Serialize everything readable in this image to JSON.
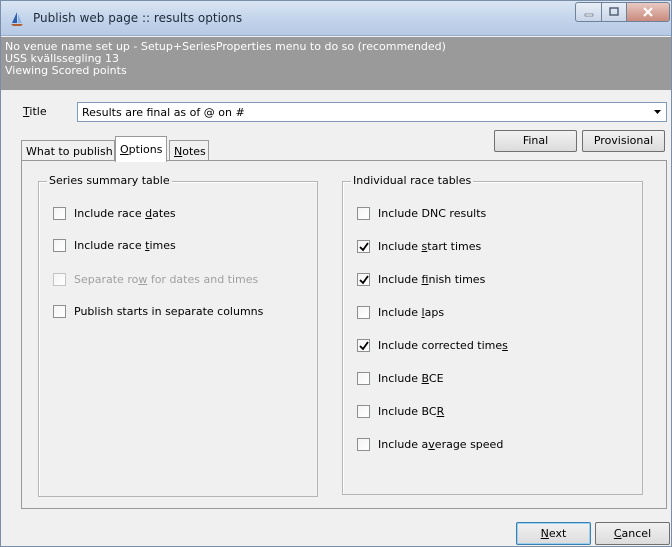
{
  "window": {
    "title": "Publish web page :: results options",
    "icon": "sailboat-icon"
  },
  "info": {
    "line1": "No venue name set up - Setup+SeriesProperties menu to do so (recommended)",
    "line2": "USS kvällssegling 13",
    "line3": "Viewing Scored points"
  },
  "title_field": {
    "label_prefix": "",
    "label_mnemonic": "T",
    "label_rest": "itle",
    "value": "Results are final as of @ on #"
  },
  "tabs": [
    {
      "label": "What to publish",
      "mnemonic_before": "",
      "mnemonic": "",
      "mnemonic_after": "What to publish"
    },
    {
      "label": "Options",
      "mnemonic_before": "",
      "mnemonic": "O",
      "mnemonic_after": "ptions",
      "active": true
    },
    {
      "label": "Notes",
      "mnemonic_before": "",
      "mnemonic": "N",
      "mnemonic_after": "otes"
    }
  ],
  "buttons": {
    "final": "Final",
    "provisional": "Provisional",
    "next_mnemonic": "N",
    "next_rest": "ext",
    "cancel_mnemonic": "C",
    "cancel_rest": "ancel"
  },
  "series_summary": {
    "legend": "Series summary table",
    "items": [
      {
        "before": "Include race ",
        "mn": "d",
        "after": "ates",
        "checked": false,
        "enabled": true
      },
      {
        "before": "Include race ",
        "mn": "t",
        "after": "imes",
        "checked": false,
        "enabled": true
      },
      {
        "before": "Separate ro",
        "mn": "w",
        "after": " for dates and times",
        "checked": false,
        "enabled": false
      },
      {
        "before": "Publish starts in separate columns",
        "mn": "",
        "after": "",
        "checked": false,
        "enabled": true
      }
    ]
  },
  "individual_race": {
    "legend": "Individual race tables",
    "items": [
      {
        "before": "Include DNC results",
        "mn": "",
        "after": "",
        "checked": false
      },
      {
        "before": "Include ",
        "mn": "s",
        "after": "tart times",
        "checked": true
      },
      {
        "before": "Include ",
        "mn": "f",
        "after": "inish times",
        "checked": true
      },
      {
        "before": "Include ",
        "mn": "l",
        "after": "aps",
        "checked": false
      },
      {
        "before": "Include corrected time",
        "mn": "s",
        "after": "",
        "checked": true
      },
      {
        "before": "Include ",
        "mn": "B",
        "after": "CE",
        "checked": false
      },
      {
        "before": "Include BC",
        "mn": "R",
        "after": "",
        "checked": false
      },
      {
        "before": "Include a",
        "mn": "v",
        "after": "erage speed",
        "checked": false
      }
    ]
  }
}
